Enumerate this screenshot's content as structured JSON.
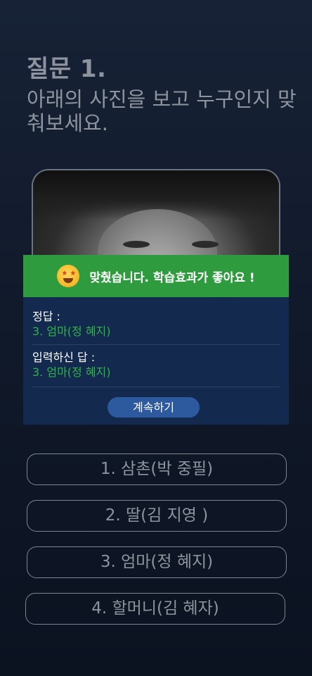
{
  "question": {
    "number": "질문 1.",
    "text": "아래의 사진을 보고 누구인지 맞춰보세요."
  },
  "photo": {
    "description_icon": "person-photo"
  },
  "result": {
    "icon": "star-struck-emoji-icon",
    "message": "맞췄습니다. 학습효과가 좋아요 !",
    "banner_color": "#2e9c3e",
    "correct_label": "정답 :",
    "correct_value": "3. 엄마(정 혜지)",
    "input_label": "입력하신 답 :",
    "input_value": "3. 엄마(정 혜지)",
    "continue_label": "계속하기"
  },
  "options": [
    {
      "label": "1. 삼촌(박 중필)"
    },
    {
      "label": "2. 딸(김 지영 )"
    },
    {
      "label": "3. 엄마(정 혜지)"
    },
    {
      "label": "4. 할머니(김 혜자)"
    }
  ]
}
